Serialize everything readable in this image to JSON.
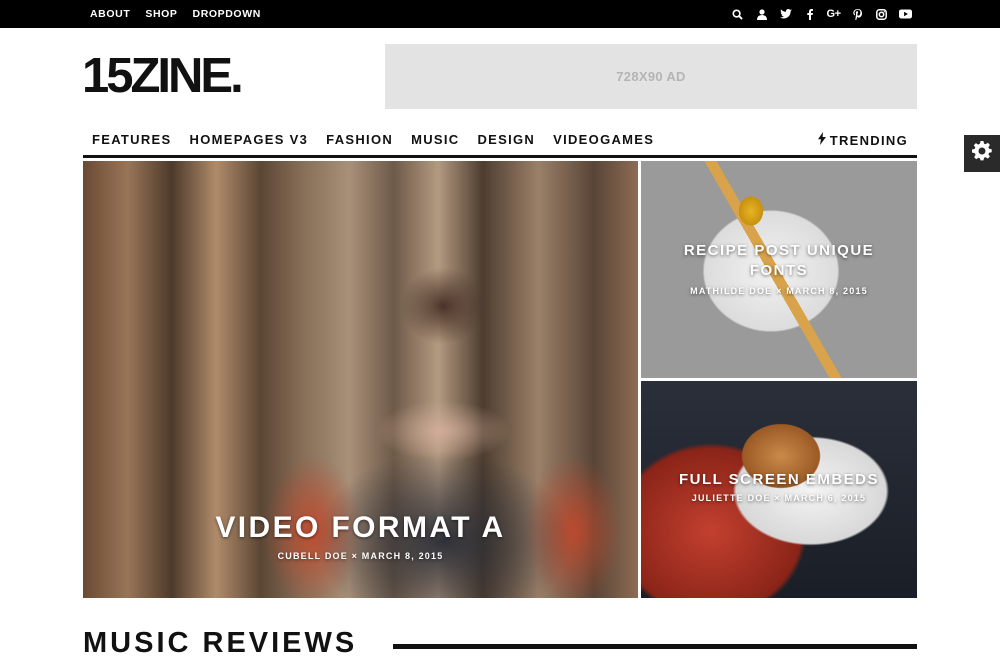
{
  "topbar": {
    "links": [
      "ABOUT",
      "SHOP",
      "DROPDOWN"
    ],
    "icons": [
      "search-icon",
      "user-icon",
      "twitter-icon",
      "facebook-icon",
      "google-plus-icon",
      "pinterest-icon",
      "instagram-icon",
      "youtube-icon"
    ],
    "google_plus": "G+"
  },
  "header": {
    "logo": "15ZINE.",
    "ad_label": "728X90 AD"
  },
  "nav": {
    "items": [
      "FEATURES",
      "HOMEPAGES V3",
      "FASHION",
      "MUSIC",
      "DESIGN",
      "VIDEOGAMES"
    ],
    "trending": "TRENDING"
  },
  "hero": {
    "main": {
      "title": "VIDEO FORMAT A",
      "author": "CUBELL DOE",
      "sep": "×",
      "date": "MARCH 8, 2015"
    },
    "side_top": {
      "title": "RECIPE POST UNIQUE FONTS",
      "author": "MATHILDE DOE",
      "sep": "×",
      "date": "MARCH 8, 2015"
    },
    "side_bottom": {
      "title": "FULL SCREEN EMBEDS",
      "author": "JULIETTE DOE",
      "sep": "×",
      "date": "MARCH 6, 2015"
    }
  },
  "section": {
    "title": "MUSIC REVIEWS"
  },
  "colors": {
    "topbar": "#000000",
    "ad_bg": "#e3e3e3",
    "text": "#111111",
    "gear_bg": "#2a2a2a"
  }
}
